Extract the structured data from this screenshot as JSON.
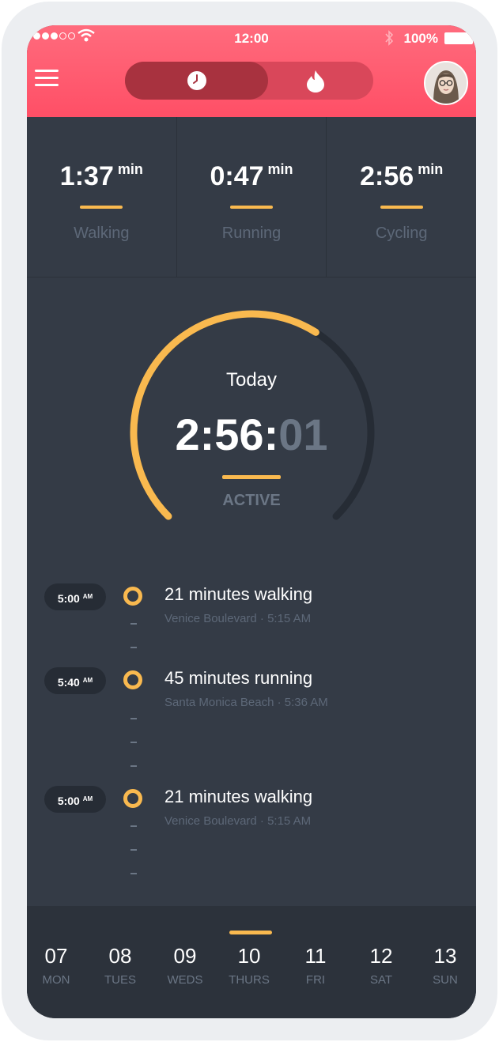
{
  "status_bar": {
    "time": "12:00",
    "battery": "100%"
  },
  "stats": [
    {
      "value": "1:37",
      "unit": "min",
      "label": "Walking"
    },
    {
      "value": "0:47",
      "unit": "min",
      "label": "Running"
    },
    {
      "value": "2:56",
      "unit": "min",
      "label": "Cycling"
    }
  ],
  "dial": {
    "title": "Today",
    "time_main": "2:56:",
    "time_seconds": "01",
    "status": "ACTIVE",
    "progress": 0.62,
    "accent": "#f9b94f"
  },
  "timeline": [
    {
      "time": "5:00",
      "ampm": "AM",
      "title": "21 minutes walking",
      "subtitle": "Venice Boulevard · 5:15 AM"
    },
    {
      "time": "5:40",
      "ampm": "AM",
      "title": "45 minutes running",
      "subtitle": "Santa Monica Beach  ·  5:36 AM"
    },
    {
      "time": "5:00",
      "ampm": "AM",
      "title": "21 minutes walking",
      "subtitle": "Venice Boulevard · 5:15 AM"
    }
  ],
  "week": [
    {
      "num": "07",
      "name": "MON"
    },
    {
      "num": "08",
      "name": "TUES"
    },
    {
      "num": "09",
      "name": "WEDS"
    },
    {
      "num": "10",
      "name": "THURS"
    },
    {
      "num": "11",
      "name": "FRI"
    },
    {
      "num": "12",
      "name": "SAT"
    },
    {
      "num": "13",
      "name": "SUN"
    }
  ],
  "colors": {
    "header": "#ff5a6e",
    "accent": "#f9b94f",
    "background": "#343b46"
  }
}
